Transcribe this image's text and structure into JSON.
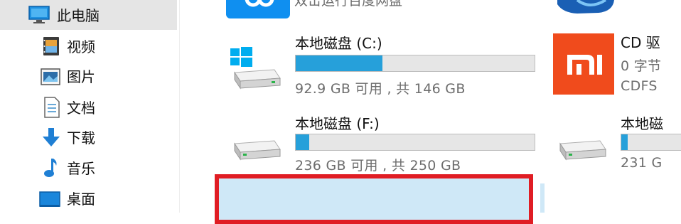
{
  "sidebar": {
    "items": [
      {
        "label": "此电脑",
        "icon": "computer-icon",
        "selected": true
      },
      {
        "label": "视频",
        "icon": "video-icon"
      },
      {
        "label": "图片",
        "icon": "pictures-icon"
      },
      {
        "label": "文档",
        "icon": "documents-icon"
      },
      {
        "label": "下载",
        "icon": "download-icon"
      },
      {
        "label": "音乐",
        "icon": "music-icon"
      },
      {
        "label": "桌面",
        "icon": "desktop-icon"
      }
    ]
  },
  "drives": [
    {
      "name": "本地磁盘 (C:)",
      "size_text": "92.9 GB 可用 , 共 146 GB",
      "used_fraction": 0.364,
      "icon": "windows-drive-icon"
    },
    {
      "name": "本地磁盘 (F:)",
      "size_text": "236 GB 可用 , 共 250 GB",
      "used_fraction": 0.056,
      "icon": "hard-drive-icon"
    },
    {
      "name": "CD 驱",
      "size_text": "0 字节",
      "fs_text": "CDFS",
      "icon": "mi-logo-icon"
    },
    {
      "name": "本地磁",
      "size_text": "231 G",
      "used_fraction": 0.08,
      "icon": "hard-drive-icon"
    }
  ],
  "top_partial_text": "双击运行百度网盘",
  "colors": {
    "accent": "#26a0da",
    "selection_outline": "#e01d24",
    "mi_brand": "#f04b1c",
    "bar_track": "#e6e6e6"
  }
}
